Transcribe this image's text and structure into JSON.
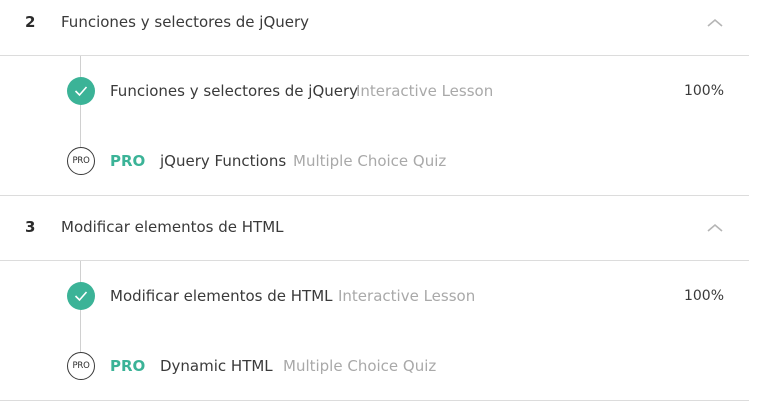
{
  "sections": [
    {
      "number": "2",
      "title": "Funciones y selectores de jQuery",
      "items": [
        {
          "title": "Funciones y selectores de jQuery",
          "type": "Interactive Lesson",
          "progress": "100%"
        },
        {
          "pro_icon": "PRO",
          "pro_label": "PRO",
          "title": "jQuery Functions",
          "type": "Multiple Choice Quiz"
        }
      ]
    },
    {
      "number": "3",
      "title": "Modificar elementos de HTML",
      "items": [
        {
          "title": "Modificar elementos de HTML",
          "type": "Interactive Lesson",
          "progress": "100%"
        },
        {
          "pro_icon": "PRO",
          "pro_label": "PRO",
          "title": "Dynamic HTML",
          "type": "Multiple Choice Quiz"
        }
      ]
    }
  ],
  "colors": {
    "accent": "#3bb397",
    "text": "#3a3a3a",
    "muted": "#a9a9a9",
    "divider": "#dcdcdc"
  },
  "icons": {
    "complete": "check-icon",
    "collapse": "chevron-up-icon",
    "pro": "pro-badge-icon"
  }
}
